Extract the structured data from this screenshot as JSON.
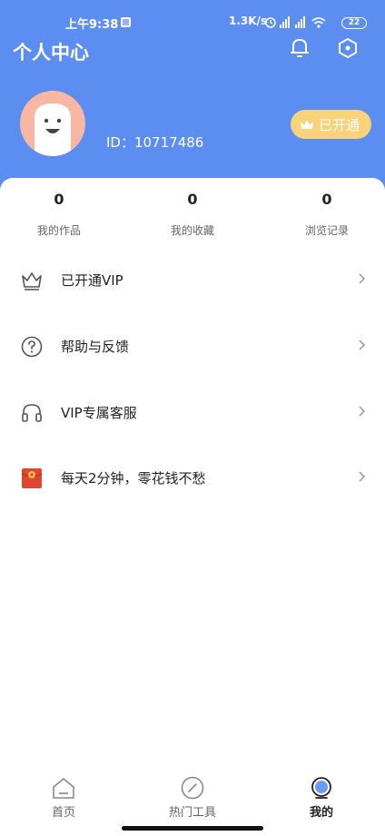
{
  "status_bar": {
    "time": "上午9:38",
    "network_speed": "1.3K/s",
    "battery": "22"
  },
  "header": {
    "title": "个人中心",
    "bell_icon": "bell-icon",
    "settings_icon": "hexagon-settings-icon"
  },
  "profile": {
    "user_id": "ID：10717486",
    "vip_badge_label": "已开通",
    "vip_badge_icon": "crown-icon"
  },
  "stats": [
    {
      "value": "0",
      "label": "我的作品"
    },
    {
      "value": "0",
      "label": "我的收藏"
    },
    {
      "value": "0",
      "label": "浏览记录"
    }
  ],
  "menu": [
    {
      "label": "已开通VIP",
      "icon": "crown-icon"
    },
    {
      "label": "帮助与反馈",
      "icon": "question-icon"
    },
    {
      "label": "VIP专属客服",
      "icon": "headset-icon"
    },
    {
      "label": "每天2分钟，零花钱不愁",
      "icon": "red-envelope-icon"
    }
  ],
  "tabbar": [
    {
      "label": "首页",
      "icon": "home-icon",
      "active": false
    },
    {
      "label": "热门工具",
      "icon": "compass-icon",
      "active": false
    },
    {
      "label": "我的",
      "icon": "profile-icon",
      "active": true
    }
  ],
  "colors": {
    "header_blue": "#5b8ef0",
    "vip_gold": "#f9d27a",
    "avatar_peach": "#f7b7a3",
    "envelope_red": "#e0452f"
  }
}
